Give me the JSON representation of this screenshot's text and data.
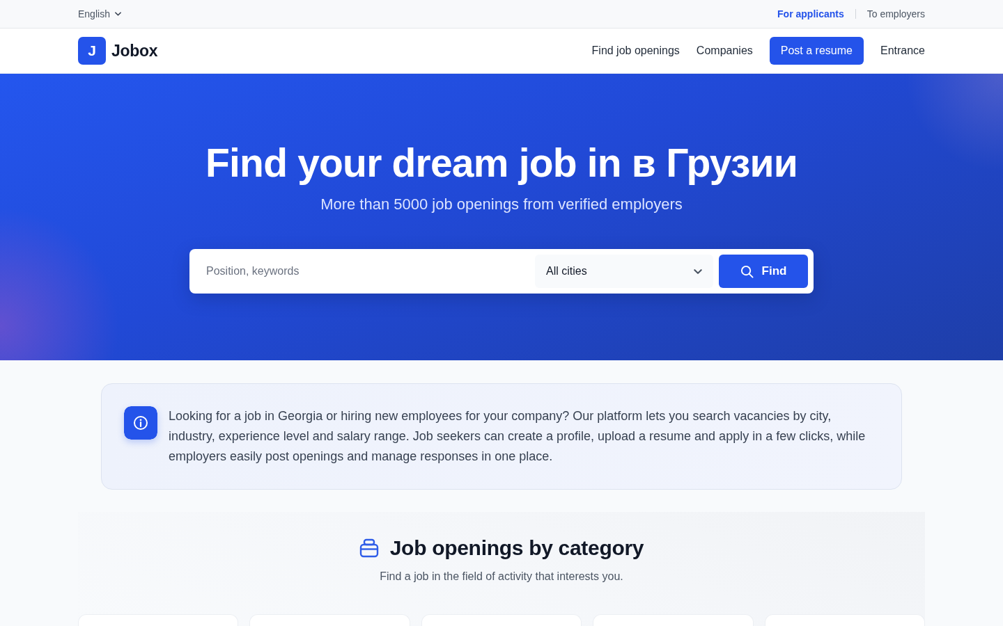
{
  "top_bar": {
    "language": "English",
    "audience_links": [
      {
        "label": "For applicants",
        "selected": true
      },
      {
        "label": "To employers",
        "selected": false
      }
    ]
  },
  "header": {
    "logo": {
      "mark": "J",
      "name": "Jobox"
    },
    "nav": [
      {
        "label": "Find job openings",
        "kind": "link"
      },
      {
        "label": "Companies",
        "kind": "link"
      },
      {
        "label": "Post a resume",
        "kind": "primary"
      },
      {
        "label": "Entrance",
        "kind": "link"
      }
    ]
  },
  "hero": {
    "title": "Find your dream job in в Грузии",
    "subtitle": "More than 5000 job openings from verified employers",
    "search": {
      "placeholder": "Position, keywords",
      "city": "All cities",
      "button": "Find"
    }
  },
  "info_card": {
    "text": "Looking for a job in Georgia or hiring new employees for your company? Our platform lets you search vacancies by city, industry, experience level and salary range. Job seekers can create a profile, upload a resume and apply in a few clicks, while employers easily post openings and manage responses in one place."
  },
  "categories": {
    "title": "Job openings by category",
    "subtitle": "Find a job in the field of activity that interests you."
  }
}
